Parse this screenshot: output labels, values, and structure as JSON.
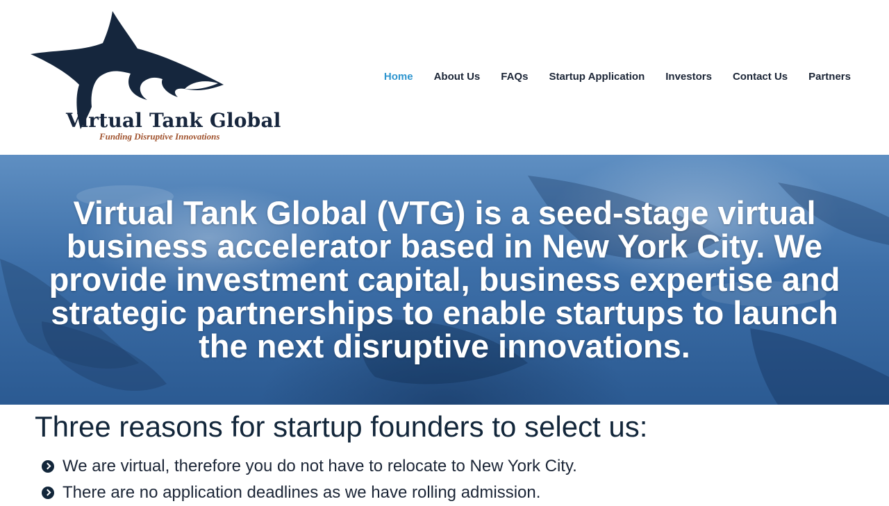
{
  "brand": {
    "name": "Virtual Tank Global",
    "tagline": "Funding Disruptive Innovations",
    "logo_icon": "shark-fin-icon",
    "primary_color": "#12263a",
    "accent_color": "#2e95cf"
  },
  "nav": {
    "items": [
      {
        "label": "Home",
        "active": true
      },
      {
        "label": "About Us"
      },
      {
        "label": "FAQs"
      },
      {
        "label": "Startup Application"
      },
      {
        "label": "Investors"
      },
      {
        "label": "Contact Us"
      },
      {
        "label": "Partners"
      }
    ]
  },
  "hero": {
    "text": "Virtual Tank Global (VTG) is a seed-stage virtual business accelerator based in New York City. We provide investment capital, business expertise and strategic partnerships to enable startups to launch the next disruptive innovations."
  },
  "reasons": {
    "heading": "Three reasons for startup founders to select us:",
    "bullet_icon": "chevron-circle-right-icon",
    "items": [
      "We are virtual, therefore you do not have to relocate to New York City.",
      "There are no application deadlines as we have rolling admission."
    ]
  }
}
